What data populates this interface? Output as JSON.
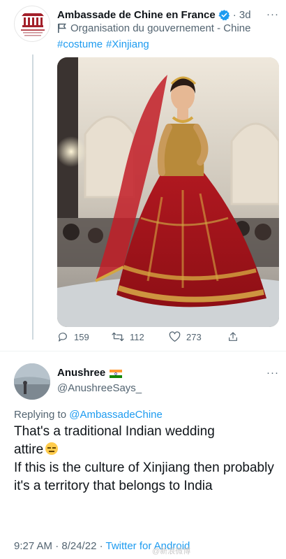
{
  "tweet": {
    "author": "Ambassade de Chine en France",
    "time": "3d",
    "affiliation": "Organisation du gouvernement - Chine",
    "hashtags": [
      "#costume",
      "#Xinjiang"
    ],
    "stats": {
      "replies": "159",
      "retweets": "112",
      "likes": "273"
    },
    "more": "···"
  },
  "reply": {
    "author": "Anushree",
    "handle": "@AnushreeSays_",
    "more": "···",
    "replying_prefix": "Replying to",
    "replying_to": "@AmbassadeChine",
    "line1": "That's a traditional Indian wedding",
    "line2": "attire",
    "line3": "If this is the culture of Xinjiang then probably it's a territory that belongs to India",
    "time": "9:27 AM · 8/24/22 ·",
    "client": "Twitter for Android"
  },
  "colors": {
    "link": "#1d9bf0",
    "muted": "#536471",
    "dress": "#b3141c"
  },
  "icons": [
    "verified-badge-icon",
    "flag-icon",
    "reply-icon",
    "retweet-icon",
    "like-icon",
    "share-icon",
    "india-flag-icon",
    "expressionless-emoji-icon"
  ]
}
